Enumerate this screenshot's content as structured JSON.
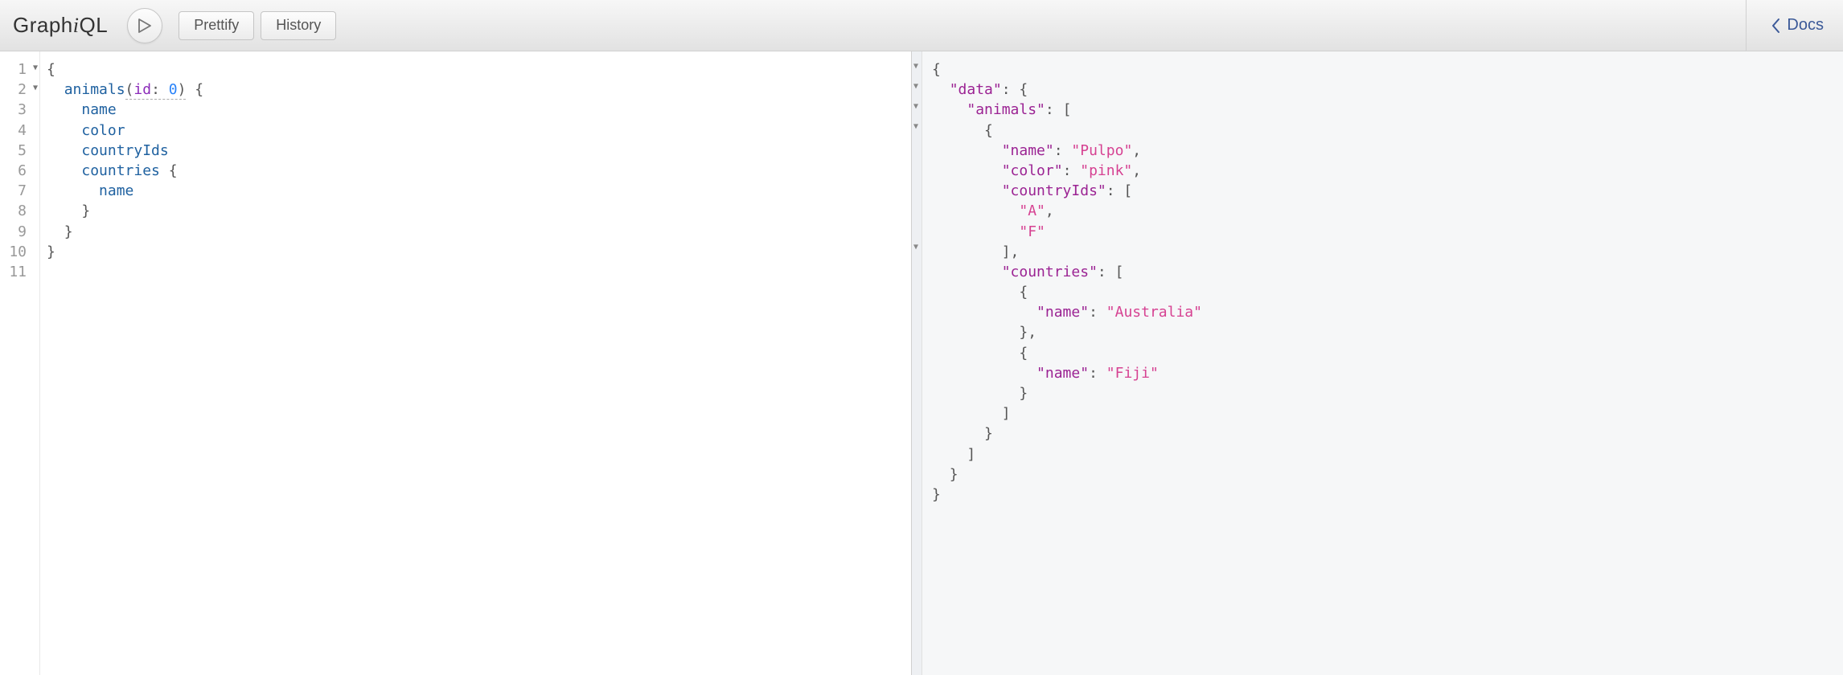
{
  "toolbar": {
    "logo_pre": "Graph",
    "logo_i": "i",
    "logo_post": "QL",
    "prettify": "Prettify",
    "history": "History",
    "docs": "Docs"
  },
  "query": {
    "line_numbers": [
      "1",
      "2",
      "3",
      "4",
      "5",
      "6",
      "7",
      "8",
      "9",
      "10",
      "11"
    ],
    "root_field": "animals",
    "arg_name": "id",
    "arg_value": "0",
    "field_name": "name",
    "field_color": "color",
    "field_countryIds": "countryIds",
    "field_countries": "countries",
    "nested_name": "name"
  },
  "result": {
    "key_data": "\"data\"",
    "key_animals": "\"animals\"",
    "key_name": "\"name\"",
    "key_color": "\"color\"",
    "key_countryIds": "\"countryIds\"",
    "key_countries": "\"countries\"",
    "val_Pulpo": "\"Pulpo\"",
    "val_pink": "\"pink\"",
    "val_A": "\"A\"",
    "val_F": "\"F\"",
    "val_Australia": "\"Australia\"",
    "val_Fiji": "\"Fiji\""
  }
}
